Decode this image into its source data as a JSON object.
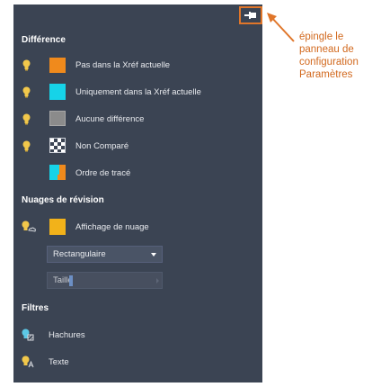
{
  "colors": {
    "panel_bg": "#3b4453",
    "accent_orange": "#e0762a",
    "bulb_yellow": "#f2c84b",
    "swatch_orange": "#f08a1c",
    "swatch_cyan": "#16d3e8",
    "swatch_gray": "#8b8b8b"
  },
  "pin_button": {
    "icon": "pin-icon"
  },
  "difference": {
    "title": "Différence",
    "items": [
      {
        "label": "Pas dans la Xréf actuelle",
        "swatch": "orange",
        "icon": "lightbulb-icon"
      },
      {
        "label": "Uniquement dans la Xréf actuelle",
        "swatch": "cyan",
        "icon": "lightbulb-icon"
      },
      {
        "label": "Aucune différence",
        "swatch": "gray",
        "icon": "lightbulb-icon"
      },
      {
        "label": "Non Comparé",
        "swatch": "checker",
        "icon": "lightbulb-icon"
      },
      {
        "label": "Ordre de tracé",
        "swatch": "draw-order"
      }
    ]
  },
  "revision_clouds": {
    "title": "Nuages de révision",
    "display_label": "Affichage de nuage",
    "shape_select": {
      "value": "Rectangulaire"
    },
    "size_field": {
      "placeholder": "Taille"
    }
  },
  "filters": {
    "title": "Filtres",
    "items": [
      {
        "label": "Hachures",
        "icon": "hatch-filter-icon"
      },
      {
        "label": "Texte",
        "icon": "text-filter-icon"
      }
    ]
  },
  "annotation": {
    "lines": [
      "épingle le",
      "panneau de",
      "configuration",
      "Paramètres"
    ]
  }
}
